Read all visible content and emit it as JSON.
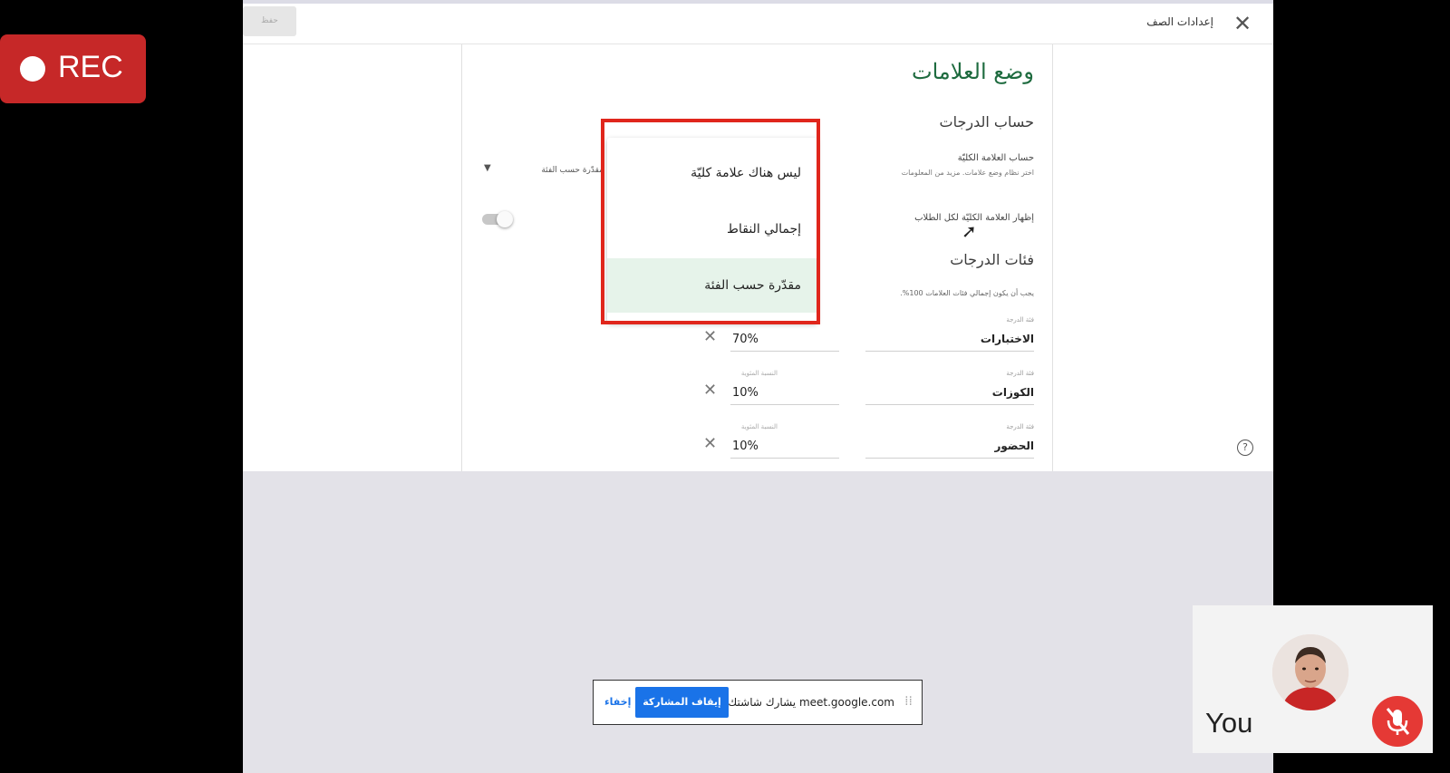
{
  "recording": {
    "label": "REC"
  },
  "app": {
    "title": "إعدادات الصف",
    "save_label": "حفظ"
  },
  "grading": {
    "heading": "وضع العلامات",
    "calc_heading": "حساب الدرجات",
    "calc_label": "حساب العلامة الكليّة",
    "calc_desc": "اختر نظام وضع علامات. مزيد من المعلومات",
    "dropdown_value": "مقدّرة حسب الفئة",
    "show_label": "إظهار العلامة الكليّة لكل الطلاب",
    "categories_heading": "فئات الدرجات",
    "sum_note": "يجب أن يكون إجمالي فئات العلامات 100%.",
    "category_label": "فئة الدرجة",
    "percent_label": "النسبة المئوية",
    "categories": [
      {
        "name": "الاختبارات",
        "percent": "70%"
      },
      {
        "name": "الكوزات",
        "percent": "10%"
      },
      {
        "name": "الحضور",
        "percent": "10%"
      }
    ]
  },
  "menu": {
    "options": [
      "ليس هناك علامة كليّة",
      "إجمالي النقاط",
      "مقدّرة حسب الفئة"
    ],
    "selected_index": 2
  },
  "share_bar": {
    "text": "meet.google.com يشارك شاشتك.",
    "stop_label": "إيقاف المشاركة",
    "hide_label": "إخفاء"
  },
  "self_view": {
    "label": "You"
  },
  "colors": {
    "accent_green": "#1e6b3f",
    "highlight": "#e0261c",
    "rec": "#c62828",
    "meet_blue": "#1a73e8",
    "mic_off": "#e53935"
  }
}
